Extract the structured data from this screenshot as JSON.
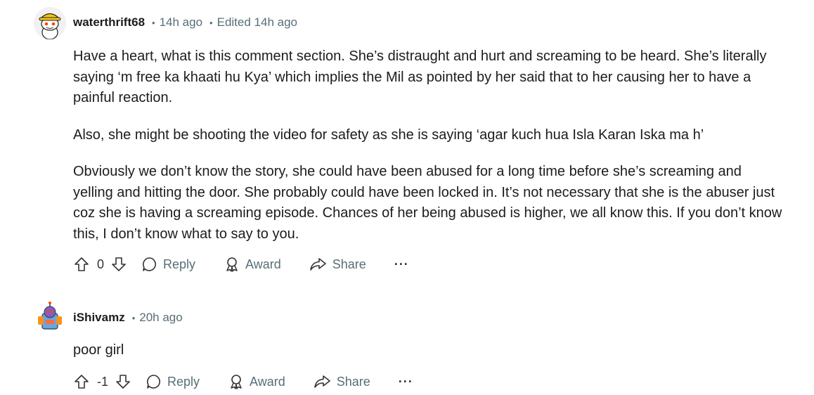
{
  "comments": [
    {
      "username": "waterthrift68",
      "time": "14h ago",
      "edited": "Edited 14h ago",
      "avatar_icon": "snoo-yellow-hat-avatar",
      "paragraphs": [
        "Have a heart, what is this comment section. She’s distraught and hurt and screaming to be heard. She’s literally saying ‘m free ka khaati hu Kya’ which implies the Mil as pointed by her said that to her causing her to have a painful reaction.",
        "Also, she might be shooting the video for safety as she is saying ‘agar kuch hua Isla Karan Iska ma h’",
        "Obviously we don’t know the story, she could have been abused for a long time before she’s screaming and yelling and hitting the door. She probably could have been locked in. It’s not necessary that she is the abuser just coz she is having a screaming episode. Chances of her being abused is higher, we all know this. If you don’t know this, I don’t know what to say to you."
      ],
      "score": "0",
      "reply_label": "Reply",
      "award_label": "Award",
      "share_label": "Share",
      "more_label": "···"
    },
    {
      "username": "iShivamz",
      "time": "20h ago",
      "avatar_icon": "snoo-blue-robot-avatar",
      "paragraphs": [
        "poor girl"
      ],
      "score": "-1",
      "reply_label": "Reply",
      "award_label": "Award",
      "share_label": "Share",
      "more_label": "···"
    }
  ],
  "colors": {
    "text": "#1c1c1c",
    "meta": "#576f76",
    "avatar1_bg": "#f2f2f2",
    "avatar2_bg": "#7fb3dd"
  }
}
